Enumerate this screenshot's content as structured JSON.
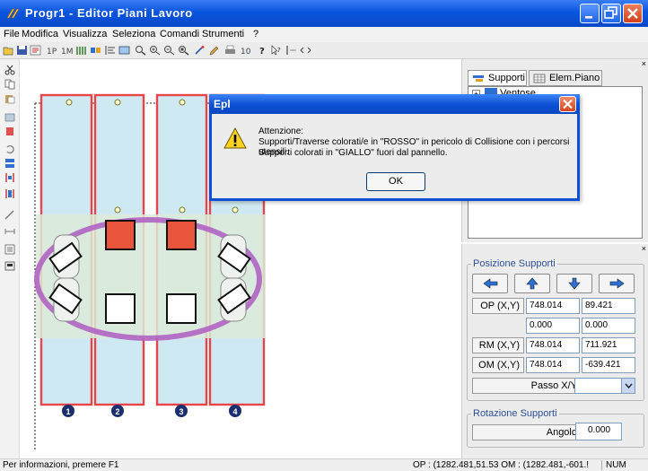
{
  "window": {
    "title": "Progr1 - Editor Piani Lavoro"
  },
  "menu": [
    "File",
    "Modifica",
    "Visualizza",
    "Seleziona",
    "Comandi",
    "Strumenti",
    "?"
  ],
  "right_panel": {
    "tabs": [
      {
        "label": "Supporti",
        "icon": "support-tree-icon"
      },
      {
        "label": "Elem.Piano",
        "icon": "grid-icon"
      }
    ],
    "tree_items": [
      {
        "label": "Ventose",
        "expander": "+"
      }
    ]
  },
  "position_panel": {
    "title": "Posizione Supporti",
    "nav_buttons": [
      "move-left-icon",
      "move-up-icon",
      "move-down-icon",
      "move-right-icon"
    ],
    "rows": [
      {
        "label": "OP (X,Y)",
        "x": "748.014",
        "y": "89.421"
      },
      {
        "label": "",
        "x": "0.000",
        "y": "0.000"
      },
      {
        "label": "RM (X,Y)",
        "x": "748.014",
        "y": "711.921"
      },
      {
        "label": "OM (X,Y)",
        "x": "748.014",
        "y": "-639.421"
      }
    ],
    "passo_label": "Passo X/Y",
    "passo_value": ""
  },
  "rotation_panel": {
    "title": "Rotazione Supporti",
    "angle_label": "Angolo",
    "angle_value": "0.000"
  },
  "dialog": {
    "title": "Epl",
    "icon": "warning-icon",
    "lines": [
      "Attenzione:",
      "Supporti/Traverse colorati/e in \"ROSSO\" in pericolo di Collisione con i percorsi utensili.",
      "Supporti colorati in \"GIALLO\" fuori dal pannello."
    ],
    "ok_label": "OK"
  },
  "canvas": {
    "columns": [
      {
        "number": "1"
      },
      {
        "number": "2"
      },
      {
        "number": "3"
      },
      {
        "number": "4"
      }
    ],
    "colors": {
      "column_fill": "#cfe9f3",
      "column_border": "#e8454a",
      "panel_fill": "#dcead8",
      "ellipse": "#b064c2",
      "red_support": "#e8553c"
    }
  },
  "status": {
    "help": "Per informazioni, premere F1",
    "coords": "OP : (1282.481,51.53 OM : (1282.481,-601.!",
    "num": "NUM"
  }
}
